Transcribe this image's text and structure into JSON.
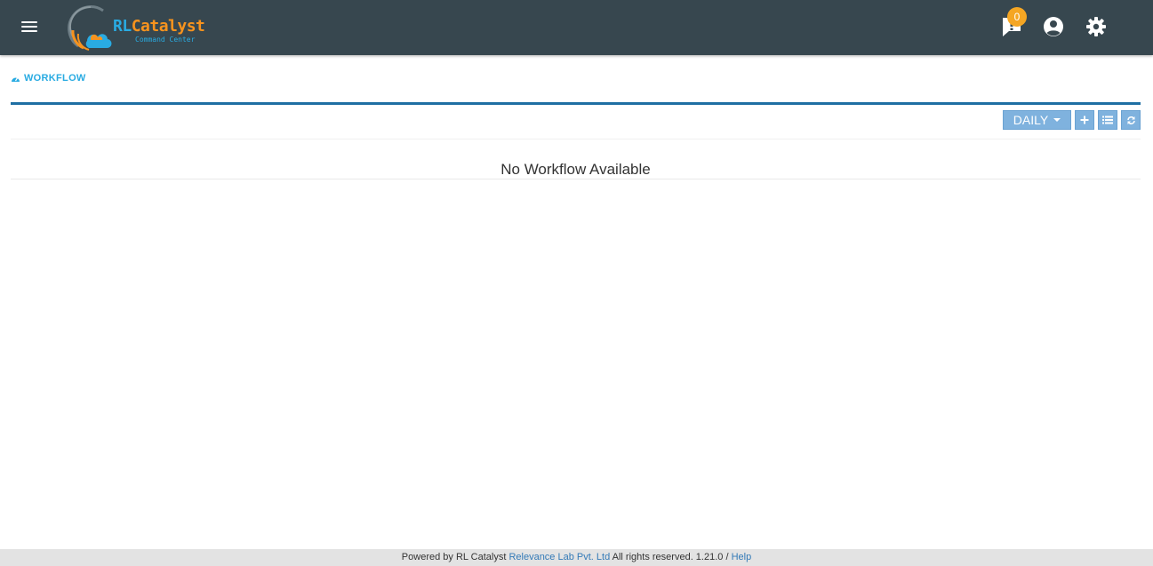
{
  "header": {
    "logo": {
      "name_rl": "RL",
      "name_rest": "Catalyst",
      "subtitle": "Command Center"
    },
    "notifications": {
      "count": "0",
      "icon": "notification-icon"
    },
    "icons": [
      "menu-icon",
      "user-account-icon",
      "settings-icon"
    ]
  },
  "section": {
    "title": "WORKFLOW",
    "icon": "dashboard-icon"
  },
  "toolbar": {
    "range_label": "DAILY",
    "range_icon": "caret-down-icon",
    "buttons": [
      "plus-icon",
      "list-icon",
      "refresh-icon"
    ]
  },
  "content": {
    "empty_message": "No Workflow Available"
  },
  "footer": {
    "prefix": "Powered by RL Catalyst",
    "company": "Relevance Lab Pvt. Ltd",
    "rights": "All rights reserved. 1.21.0 /",
    "help": "Help"
  },
  "colors": {
    "topbar": "#37474f",
    "accent": "#29abe2",
    "panel_border": "#1e6fa3",
    "button": "#7fb2de",
    "badge": "#f5a623",
    "logo_orange": "#f7931e"
  }
}
